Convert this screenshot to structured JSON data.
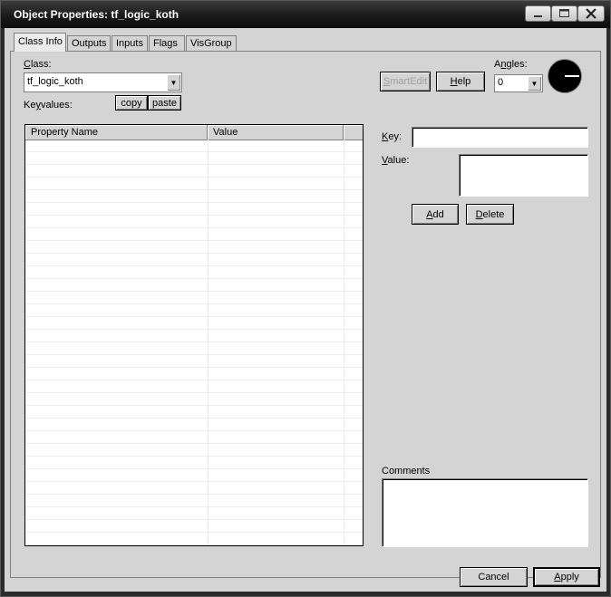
{
  "window": {
    "title": "Object Properties: tf_logic_koth"
  },
  "tabs": [
    "Class Info",
    "Outputs",
    "Inputs",
    "Flags",
    "VisGroup"
  ],
  "class_info": {
    "class_label": "Class:",
    "class_value": "tf_logic_koth",
    "keyvalues_label": "Keyvalues:",
    "copy_label": "copy",
    "paste_label": "paste",
    "smartedit_label": "SmartEdit",
    "help_label": "Help",
    "angles_label": "Angles:",
    "angles_value": "0",
    "grid": {
      "columns": [
        "Property Name",
        "Value"
      ]
    },
    "key_label": "Key:",
    "key_value": "",
    "value_label": "Value:",
    "value_value": "",
    "add_label": "Add",
    "delete_label": "Delete",
    "comments_label": "Comments",
    "comments_value": ""
  },
  "footer": {
    "cancel_label": "Cancel",
    "apply_label": "Apply"
  }
}
